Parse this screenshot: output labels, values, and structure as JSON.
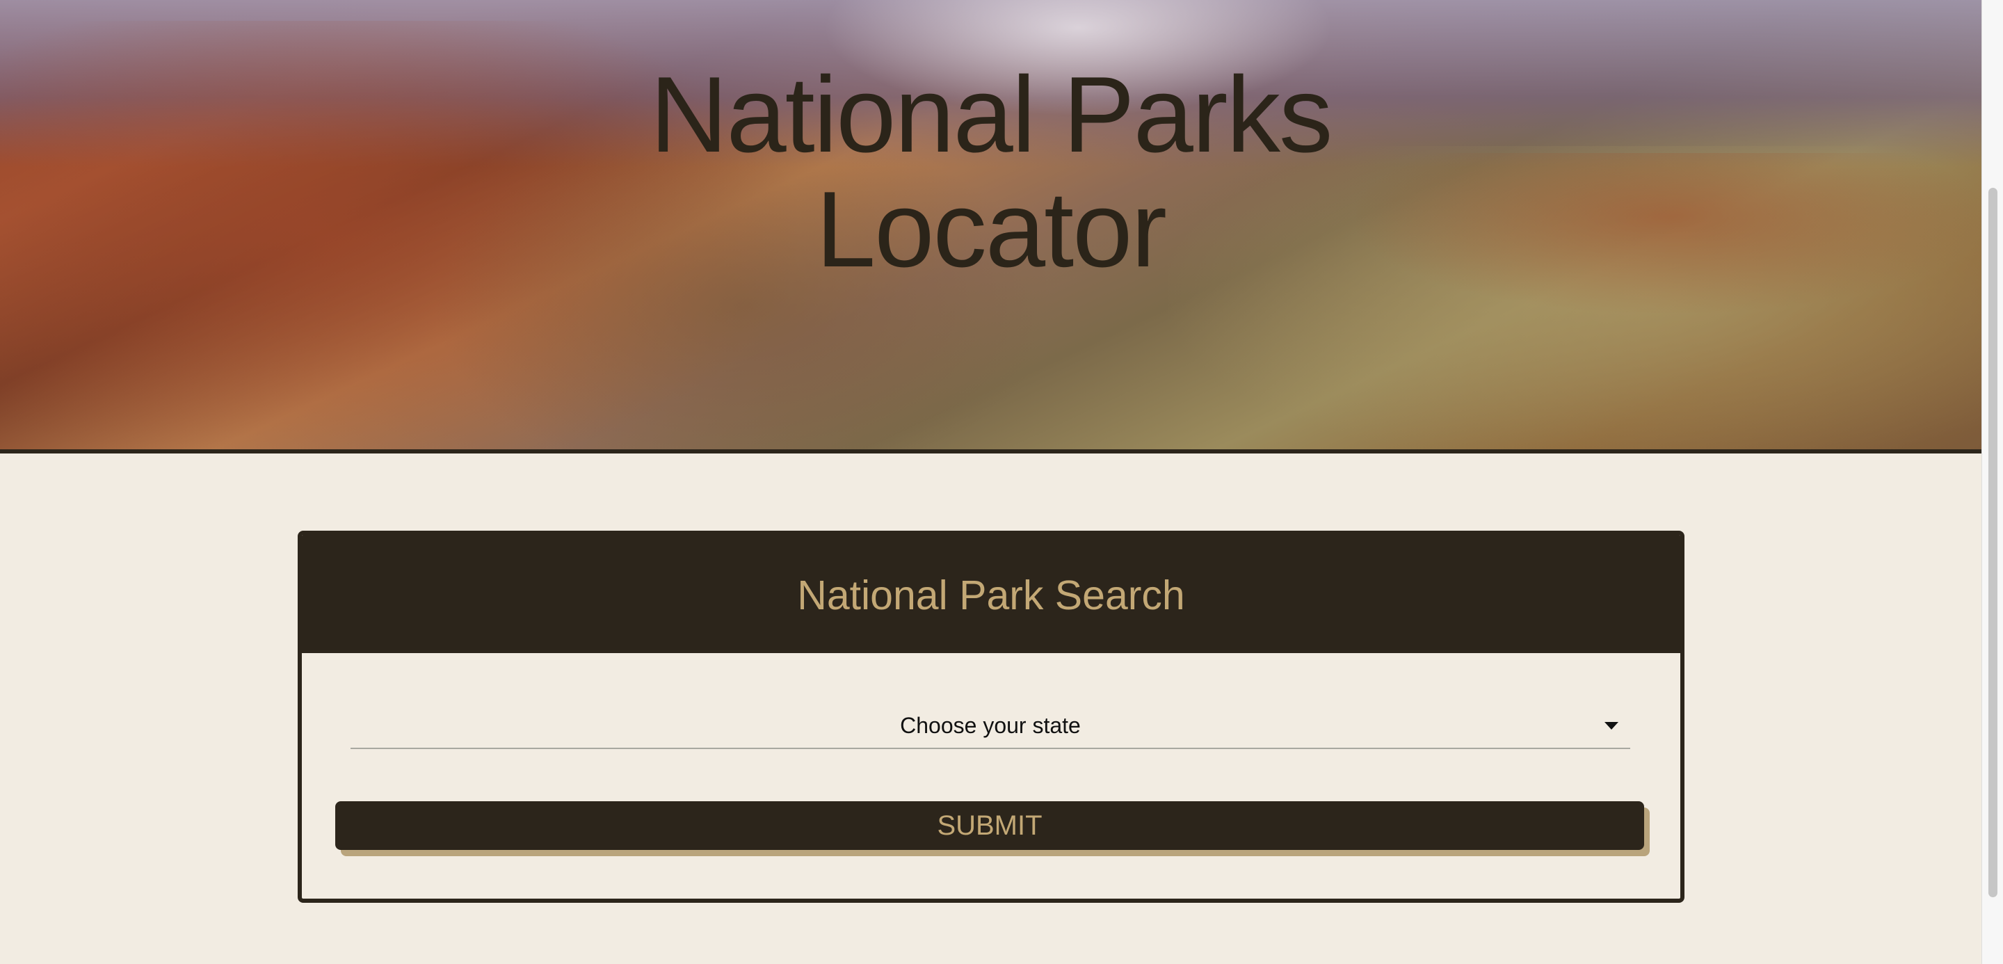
{
  "hero": {
    "title_line1": "National Parks",
    "title_line2": "Locator",
    "background_image": "grand-canyon-landscape"
  },
  "search_card": {
    "title": "National Park Search",
    "state_select": {
      "selected_value": "Choose your state",
      "icon": "caret-down-icon"
    },
    "submit_label": "SUBMIT"
  },
  "colors": {
    "page_background": "#f2ece2",
    "primary_dark": "#2c251b",
    "accent_tan": "#c3a875",
    "button_shadow": "#b9a47c"
  }
}
